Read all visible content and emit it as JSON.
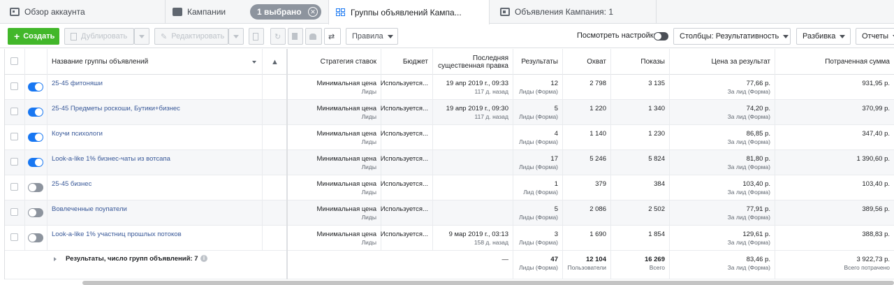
{
  "tabs": {
    "account": "Обзор аккаунта",
    "campaigns": "Кампании",
    "selected_pill": "1 выбрано",
    "adsets": "Группы объявлений Кампа...",
    "ads": "Объявления Кампания: 1"
  },
  "toolbar": {
    "create": "Создать",
    "duplicate": "Дублировать",
    "edit": "Редактировать",
    "rules": "Правила",
    "view_settings": "Посмотреть настройки",
    "columns": "Столбцы: Результативность",
    "breakdown": "Разбивка",
    "reports": "Отчеты"
  },
  "table": {
    "headers": {
      "name": "Название группы объявлений",
      "bid": "Стратегия ставок",
      "budget": "Бюджет",
      "last_edit_1": "Последняя",
      "last_edit_2": "существенная правка",
      "results": "Результаты",
      "reach": "Охват",
      "impressions": "Показы",
      "cpr": "Цена за результат",
      "spent": "Потраченная сумма"
    },
    "rows": [
      {
        "on": true,
        "name": "25-45 фитоняши",
        "bid": "Минимальная цена",
        "bid_sub": "Лиды",
        "budget": "Используется...",
        "edit": "19 апр 2019 г., 09:33",
        "edit_sub": "117 д. назад",
        "res": "12",
        "res_sub": "Лиды (Форма)",
        "reach": "2 798",
        "impr": "3 135",
        "cpr": "77,66 р.",
        "cpr_sub": "За лид (Форма)",
        "spent": "931,95 р."
      },
      {
        "on": true,
        "name": "25-45 Предметы роскоши, Бутики+бизнес",
        "bid": "Минимальная цена",
        "bid_sub": "Лиды",
        "budget": "Используется...",
        "edit": "19 апр 2019 г., 09:30",
        "edit_sub": "117 д. назад",
        "res": "5",
        "res_sub": "Лиды (Форма)",
        "reach": "1 220",
        "impr": "1 340",
        "cpr": "74,20 р.",
        "cpr_sub": "За лид (Форма)",
        "spent": "370,99 р."
      },
      {
        "on": true,
        "name": "Коучи психологи",
        "bid": "Минимальная цена",
        "bid_sub": "Лиды",
        "budget": "Используется...",
        "edit": "",
        "edit_sub": "",
        "res": "4",
        "res_sub": "Лиды (Форма)",
        "reach": "1 140",
        "impr": "1 230",
        "cpr": "86,85 р.",
        "cpr_sub": "За лид (Форма)",
        "spent": "347,40 р."
      },
      {
        "on": true,
        "name": "Look-a-like 1% бизнес-чаты из вотсапа",
        "bid": "Минимальная цена",
        "bid_sub": "Лиды",
        "budget": "Используется...",
        "edit": "",
        "edit_sub": "",
        "res": "17",
        "res_sub": "Лиды (Форма)",
        "reach": "5 246",
        "impr": "5 824",
        "cpr": "81,80 р.",
        "cpr_sub": "За лид (Форма)",
        "spent": "1 390,60 р."
      },
      {
        "on": false,
        "name": "25-45 бизнес",
        "bid": "Минимальная цена",
        "bid_sub": "Лиды",
        "budget": "Используется...",
        "edit": "",
        "edit_sub": "",
        "res": "1",
        "res_sub": "Лид (Форма)",
        "reach": "379",
        "impr": "384",
        "cpr": "103,40 р.",
        "cpr_sub": "За лид (Форма)",
        "spent": "103,40 р."
      },
      {
        "on": false,
        "name": "Вовлеченные поупатели",
        "bid": "Минимальная цена",
        "bid_sub": "Лиды",
        "budget": "Используется...",
        "edit": "",
        "edit_sub": "",
        "res": "5",
        "res_sub": "Лиды (Форма)",
        "reach": "2 086",
        "impr": "2 502",
        "cpr": "77,91 р.",
        "cpr_sub": "За лид (Форма)",
        "spent": "389,56 р."
      },
      {
        "on": false,
        "name": "Look-a-like 1% участниц прошлых потоков",
        "bid": "Минимальная цена",
        "bid_sub": "Лиды",
        "budget": "Используется...",
        "edit": "9 мар 2019 г., 03:13",
        "edit_sub": "158 д. назад",
        "res": "3",
        "res_sub": "Лиды (Форма)",
        "reach": "1 690",
        "impr": "1 854",
        "cpr": "129,61 р.",
        "cpr_sub": "За лид (Форма)",
        "spent": "388,83 р."
      }
    ],
    "totals": {
      "label": "Результаты, число групп объявлений: 7",
      "edit": "—",
      "res": "47",
      "res_sub": "Лиды (Форма)",
      "reach": "12 104",
      "reach_sub": "Пользователи",
      "impr": "16 269",
      "impr_sub": "Всего",
      "cpr": "83,46 р.",
      "cpr_sub": "За лид (Форма)",
      "spent": "3 922,73 р.",
      "spent_sub": "Всего потрачено"
    }
  },
  "colors": {
    "accent": "#1877f2",
    "create": "#42b72a",
    "link": "#385898"
  }
}
